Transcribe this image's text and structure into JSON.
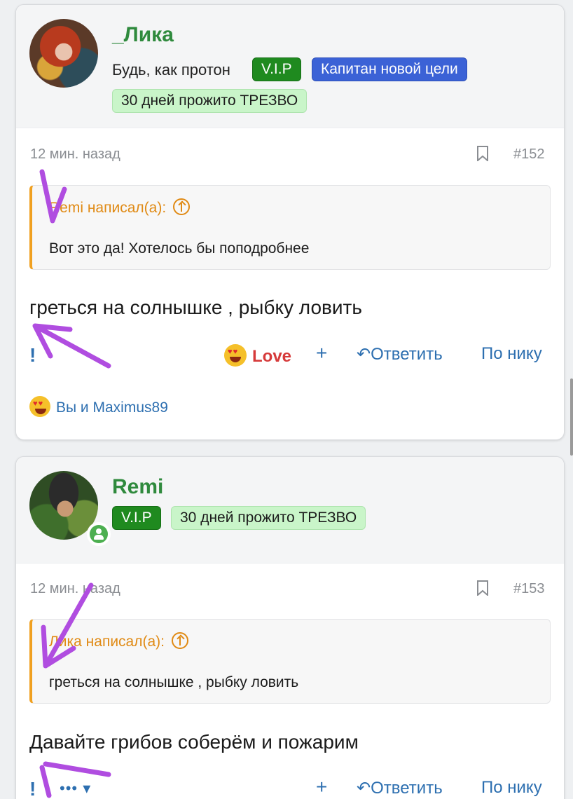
{
  "posts": [
    {
      "username": "_Лика",
      "status": "Будь, как протон",
      "badges": {
        "vip": "V.I.P",
        "captain": "Капитан новой цели",
        "sober": "30 дней прожито ТРЕЗВО"
      },
      "time": "12 мин. назад",
      "number": "#152",
      "quote": {
        "author": "Remi написал(а):",
        "text": "Вот это да! Хотелось бы поподробнее"
      },
      "text": "греться на солнышке , рыбку ловить",
      "actions": {
        "report": "!",
        "reaction": "Love",
        "plus": "+",
        "reply": "Ответить",
        "by_nick": "По нику"
      },
      "reactions_summary": "Вы и Maximus89"
    },
    {
      "username": "Remi",
      "badges": {
        "vip": "V.I.P",
        "sober": "30 дней прожито ТРЕЗВО"
      },
      "time": "12 мин. назад",
      "number": "#153",
      "quote": {
        "author": "Лика написал(а):",
        "text": "греться на солнышке , рыбку ловить"
      },
      "text": "Давайте грибов соберём и пожарим",
      "actions": {
        "report": "!",
        "more": "•••",
        "plus": "+",
        "reply": "Ответить",
        "by_nick": "По нику"
      }
    }
  ],
  "colors": {
    "username": "#2f8a3d",
    "vip": "#1f8a1f",
    "captain": "#3b62d6",
    "sober": "#c9f5c9",
    "link": "#2d6fb0",
    "quote_accent": "#f0a020",
    "annotation": "#b04de0"
  },
  "icons": {
    "bookmark": "bookmark-icon",
    "reply": "reply-arrow-icon",
    "quote_up": "arrow-up-circle-icon",
    "love": "heart-eyes-emoji-icon",
    "online": "user-online-icon"
  }
}
